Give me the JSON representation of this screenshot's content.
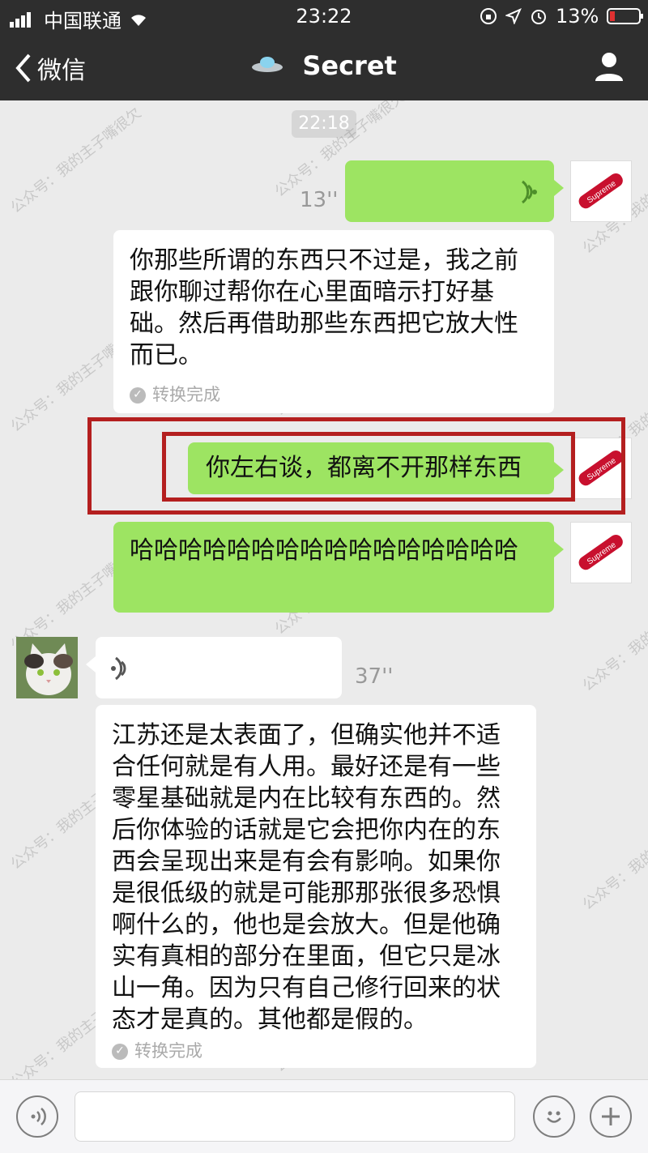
{
  "status_bar": {
    "carrier": "中国联通",
    "time": "23:22",
    "battery": "13%"
  },
  "nav": {
    "back_label": "微信",
    "title": "Secret"
  },
  "timestamp": "22:18",
  "messages": [
    {
      "side": "right",
      "type": "voice",
      "duration": "13''"
    },
    {
      "side": "right",
      "type": "converted_text",
      "text": "你那些所谓的东西只不过是，我之前跟你聊过帮你在心里面暗示打好基础。然后再借助那些东西把它放大性而已。",
      "converted_label": "转换完成"
    },
    {
      "side": "right",
      "type": "text",
      "text": "你左右谈，都离不开那样东西"
    },
    {
      "side": "right",
      "type": "text",
      "text": "哈哈哈哈哈哈哈哈哈哈哈哈哈哈哈哈"
    },
    {
      "side": "left",
      "type": "voice",
      "duration": "37''"
    },
    {
      "side": "left",
      "type": "converted_text",
      "text": "江苏还是太表面了，但确实他并不适合任何就是有人用。最好还是有一些零星基础就是内在比较有东西的。然后你体验的话就是它会把你内在的东西会呈现出来是有会有影响。如果你是很低级的就是可能那那张很多恐惧啊什么的，他也是会放大。但是他确实有真相的部分在里面，但它只是冰山一角。因为只有自己修行回来的状态才是真的。其他都是假的。",
      "converted_label": "转换完成"
    }
  ],
  "watermark": "公众号：我的主子嘴很欠",
  "avatar_logo": "Supreme",
  "colors": {
    "topbar": "#2e2e2e",
    "bubble_green": "#9de462",
    "highlight_red": "#b41f1f"
  }
}
